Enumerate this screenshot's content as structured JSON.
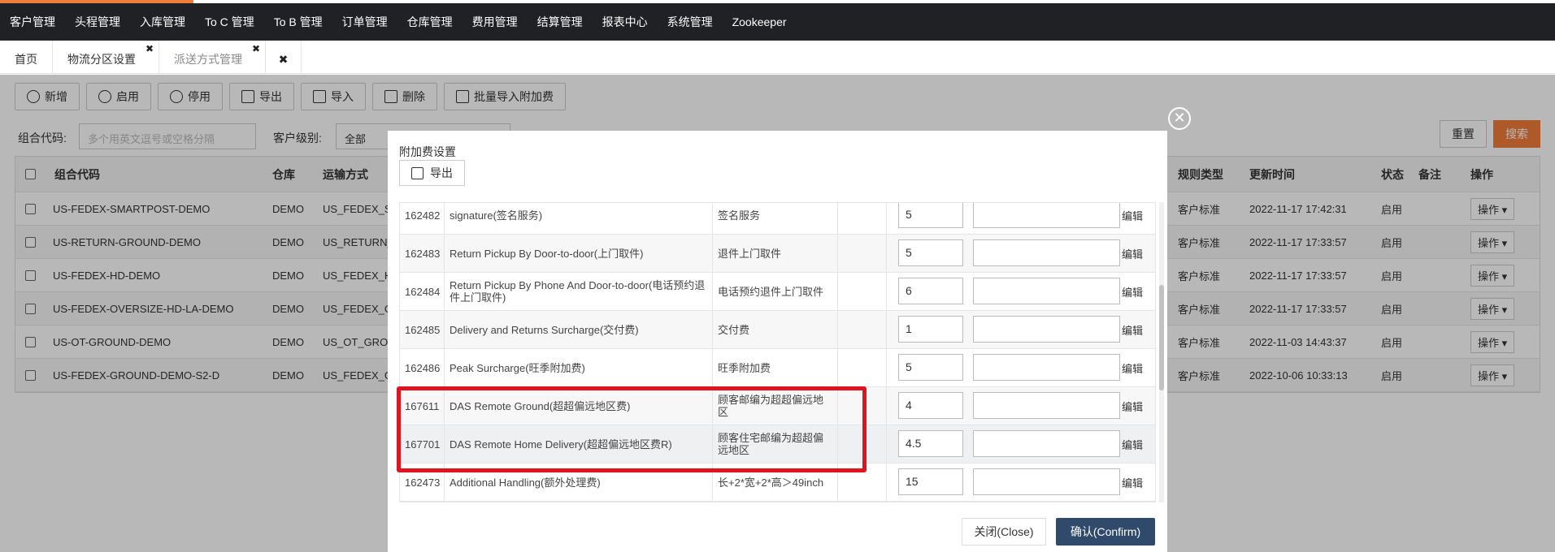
{
  "nav": [
    "客户管理",
    "头程管理",
    "入库管理",
    "To C 管理",
    "To B 管理",
    "订单管理",
    "仓库管理",
    "费用管理",
    "结算管理",
    "报表中心",
    "系统管理",
    "Zookeeper"
  ],
  "tabs": [
    {
      "label": "首页",
      "closable": false
    },
    {
      "label": "物流分区设置",
      "closable": true
    },
    {
      "label": "派送方式管理",
      "closable": true
    }
  ],
  "tab_close_glyph": "✖",
  "toolbar": [
    "新增",
    "启用",
    "停用",
    "导出",
    "导入",
    "删除",
    "批量导入附加费"
  ],
  "filters": {
    "group_code_label": "组合代码:",
    "group_code_placeholder": "多个用英文逗号或空格分隔",
    "customer_level_label": "客户级别:",
    "customer_level_value": "全部",
    "reset": "重置",
    "search": "搜索"
  },
  "bg_table": {
    "headers": {
      "code": "组合代码",
      "warehouse": "仓库",
      "transport": "运输方式",
      "rule_type": "规则类型",
      "updated": "更新时间",
      "status": "状态",
      "remark": "备注",
      "op": "操作"
    },
    "rows": [
      {
        "code": "US-FEDEX-SMARTPOST-DEMO",
        "warehouse": "DEMO",
        "transport": "US_FEDEX_SM",
        "rule_type": "客户标准",
        "updated": "2022-11-17 17:42:31",
        "status": "启用",
        "op": "操作 ▾"
      },
      {
        "code": "US-RETURN-GROUND-DEMO",
        "warehouse": "DEMO",
        "transport": "US_RETURN_G",
        "rule_type": "客户标准",
        "updated": "2022-11-17 17:33:57",
        "status": "启用",
        "op": "操作 ▾"
      },
      {
        "code": "US-FEDEX-HD-DEMO",
        "warehouse": "DEMO",
        "transport": "US_FEDEX_HD",
        "rule_type": "客户标准",
        "updated": "2022-11-17 17:33:57",
        "status": "启用",
        "op": "操作 ▾"
      },
      {
        "code": "US-FEDEX-OVERSIZE-HD-LA-DEMO",
        "warehouse": "DEMO",
        "transport": "US_FEDEX_OV",
        "rule_type": "客户标准",
        "updated": "2022-11-17 17:33:57",
        "status": "启用",
        "op": "操作 ▾"
      },
      {
        "code": "US-OT-GROUND-DEMO",
        "warehouse": "DEMO",
        "transport": "US_OT_GROUN",
        "rule_type": "客户标准",
        "updated": "2022-11-03 14:43:37",
        "status": "启用",
        "op": "操作 ▾"
      },
      {
        "code": "US-FEDEX-GROUND-DEMO-S2-D",
        "warehouse": "DEMO",
        "transport": "US_FEDEX_GR",
        "rule_type": "客户标准",
        "updated": "2022-10-06 10:33:13",
        "status": "启用",
        "op": "操作 ▾"
      }
    ]
  },
  "modal": {
    "title": "附加费设置",
    "export": "导出",
    "close_x": "✕",
    "close_button": "关闭(Close)",
    "confirm_button": "确认(Confirm)",
    "edit_label": "编辑",
    "rows": [
      {
        "id": "162482",
        "name": "signature(签名服务)",
        "desc": "签名服务",
        "value": "5"
      },
      {
        "id": "162483",
        "name": "Return Pickup By Door-to-door(上门取件)",
        "desc": "退件上门取件",
        "value": "5"
      },
      {
        "id": "162484",
        "name": "Return Pickup By Phone And Door-to-door(电话预约退件上门取件)",
        "desc": "电话预约退件上门取件",
        "value": "6"
      },
      {
        "id": "162485",
        "name": "Delivery and Returns Surcharge(交付费)",
        "desc": "交付费",
        "value": "1"
      },
      {
        "id": "162486",
        "name": "Peak Surcharge(旺季附加费)",
        "desc": "旺季附加费",
        "value": "5"
      },
      {
        "id": "167611",
        "name": "DAS Remote Ground(超超偏远地区费)",
        "desc": "顾客邮编为超超偏远地区",
        "value": "4"
      },
      {
        "id": "167701",
        "name": "DAS Remote Home Delivery(超超偏远地区费R)",
        "desc": "顾客住宅邮编为超超偏远地区",
        "value": "4.5"
      },
      {
        "id": "162473",
        "name": "Additional Handling(额外处理费)",
        "desc": "长+2*宽+2*高＞49inch",
        "value": "15"
      }
    ]
  }
}
